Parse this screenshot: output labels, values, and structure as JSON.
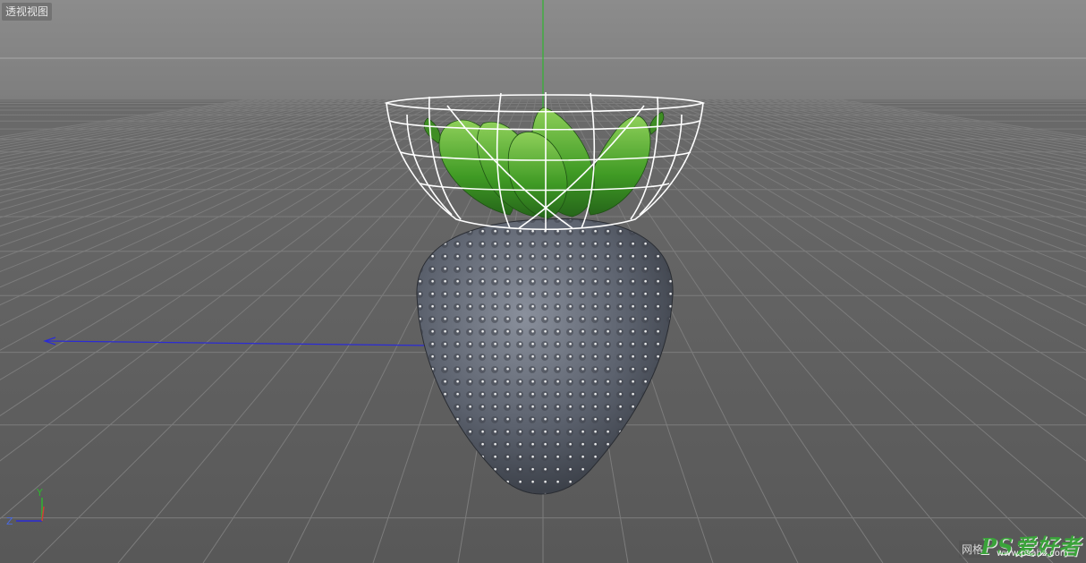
{
  "viewport": {
    "view_label": "透视视图",
    "grid_spacing_label": "网格"
  },
  "axis_gizmo": {
    "y_label": "Y",
    "z_label": "Z"
  },
  "watermark": {
    "logo_text": "PS爱好者",
    "url_text": "www.psahz.com"
  },
  "colors": {
    "background_top": "#8a8a8a",
    "background_floor": "#5a5a5a",
    "grid_line": "#7b7b7b",
    "horizon_line": "#b0b0b0",
    "y_axis": "#2fb52f",
    "x_axis": "#2b2bd6",
    "leaf_green": "#4a9e2a",
    "strawberry_body": "#5e6470",
    "wireframe": "#ffffff"
  }
}
